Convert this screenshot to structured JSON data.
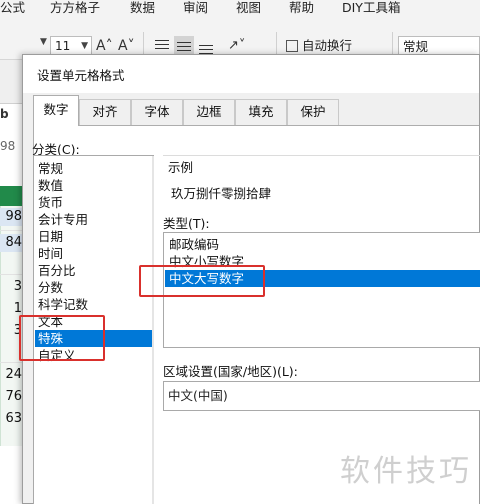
{
  "ribbon": {
    "menu_items": [
      "公式",
      "方方格子",
      "数据",
      "审阅",
      "视图",
      "帮助",
      "DIY工具箱"
    ],
    "font_size": "11",
    "grow_font": "A˄",
    "shrink_font": "A˅",
    "wrap_text_label": "自动换行",
    "number_format_value": "常规"
  },
  "sheet": {
    "header_fragments": [
      "b",
      "98"
    ],
    "column_label": "",
    "values": [
      "98",
      "84",
      "3",
      "1",
      "3",
      "24",
      "76",
      "63"
    ]
  },
  "dialog": {
    "title": "设置单元格格式",
    "tabs": [
      "数字",
      "对齐",
      "字体",
      "边框",
      "填充",
      "保护"
    ],
    "active_tab": "数字",
    "category_label": "分类(C):",
    "categories": [
      "常规",
      "数值",
      "货币",
      "会计专用",
      "日期",
      "时间",
      "百分比",
      "分数",
      "科学记数",
      "文本",
      "特殊",
      "自定义"
    ],
    "selected_category": "特殊",
    "sample_label": "示例",
    "sample_value": "玖万捌仟零捌拾肆",
    "type_label": "类型(T):",
    "types": [
      "邮政编码",
      "中文小写数字",
      "中文大写数字"
    ],
    "selected_type": "中文大写数字",
    "locale_label": "区域设置(国家/地区)(L):",
    "locale_value": "中文(中国)"
  },
  "watermark": "软件技巧",
  "colors": {
    "selection": "#0078d7",
    "highlight_box": "#d9302c",
    "excel_green": "#218a4a"
  }
}
